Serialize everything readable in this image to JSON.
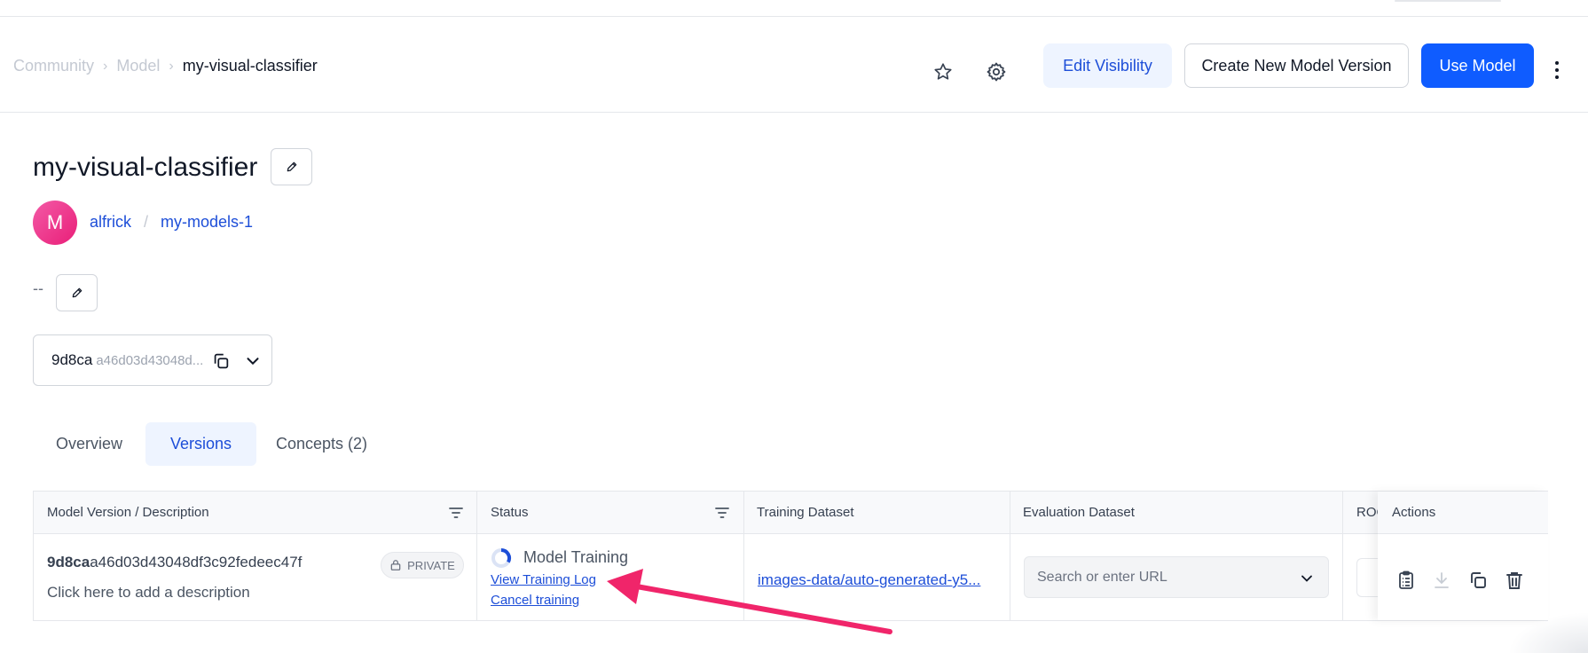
{
  "breadcrumb": {
    "items": [
      "Community",
      "Model"
    ],
    "current": "my-visual-classifier"
  },
  "header": {
    "edit_visibility": "Edit Visibility",
    "create_version": "Create New Model Version",
    "use_model": "Use Model",
    "icons": [
      "star-icon",
      "gear-icon",
      "more-vertical-icon"
    ]
  },
  "model": {
    "title": "my-visual-classifier",
    "avatar_letter": "M",
    "owner": "alfrick",
    "app": "my-models-1",
    "description": "--"
  },
  "version_selector": {
    "short_id": "9d8ca",
    "long_id": "a46d03d43048d..."
  },
  "tabs": [
    {
      "label": "Overview",
      "active": false
    },
    {
      "label": "Versions",
      "active": true
    },
    {
      "label": "Concepts (2)",
      "active": false
    }
  ],
  "table": {
    "columns": [
      "Model Version / Description",
      "Status",
      "Training Dataset",
      "Evaluation Dataset",
      "ROC",
      "Actions"
    ],
    "rows": [
      {
        "version_short": "9d8ca",
        "version_rest": "a46d03d43048df3c92fedeec47f",
        "visibility": "PRIVATE",
        "description": "Click here to add a description",
        "status": "Model Training",
        "view_log": "View Training Log",
        "cancel": "Cancel training",
        "training_dataset": "images-data/auto-generated-y5...",
        "eval_placeholder": "Search or enter URL"
      }
    ],
    "action_icons": [
      "clipboard-icon",
      "download-icon",
      "copy-icon",
      "trash-icon"
    ]
  },
  "colors": {
    "primary": "#0f5cff",
    "link": "#1d4ed8",
    "annotation_arrow": "#f0256a"
  }
}
